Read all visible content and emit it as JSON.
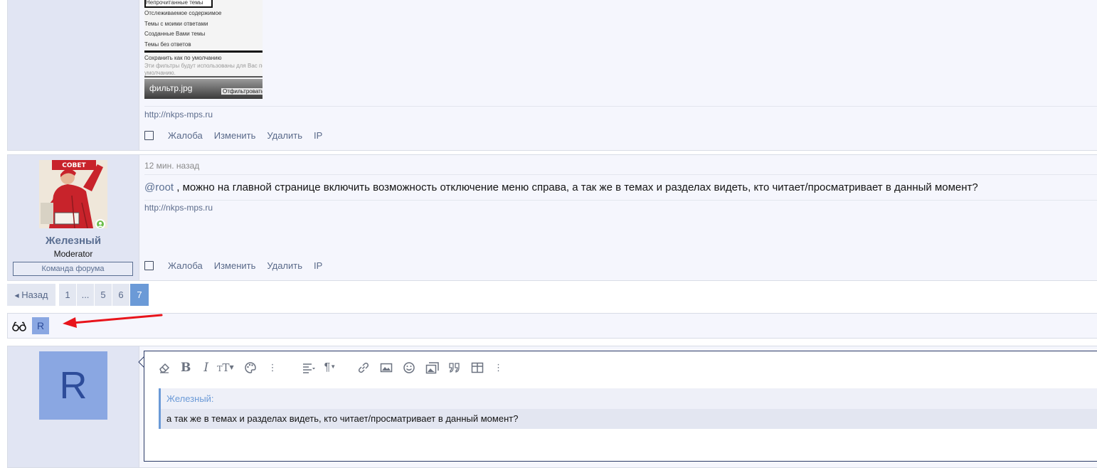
{
  "post1": {
    "attachment": {
      "menu_items": [
        "Непрочитанные темы",
        "Отслеживаемое содержимое",
        "Темы с моими ответами",
        "Созданные Вами темы",
        "Темы без ответов"
      ],
      "save_default": "Сохранить как по умолчанию",
      "save_hint_1": "Эти фильтры будут использованы для Вас по",
      "save_hint_2": "умолчанию.",
      "filename": "фильтр.jpg",
      "apply_button": "Отфильтровать"
    },
    "signature": "http://nkps-mps.ru",
    "actions": [
      "Жалоба",
      "Изменить",
      "Удалить",
      "IP"
    ]
  },
  "post2": {
    "user": {
      "name": "Железный",
      "title": "Moderator",
      "banner": "Команда форума"
    },
    "time": "12 мин. назад",
    "mention": "@root",
    "text": ", можно на главной странице включить возможность отключение меню справа, а так же в темах и разделах видеть, кто читает/просматривает в данный момент?",
    "signature": "http://nkps-mps.ru",
    "actions": [
      "Жалоба",
      "Изменить",
      "Удалить",
      "IP"
    ]
  },
  "pagination": {
    "prev": "Назад",
    "pages": [
      "1",
      "...",
      "5",
      "6",
      "7"
    ],
    "current": "7"
  },
  "readers": {
    "icon": "glasses-icon",
    "avatar_letter": "R"
  },
  "reply": {
    "avatar_letter": "R",
    "quote_author": "Железный:",
    "quote_text": "а так же в темах и разделах видеть, кто читает/просматривает в данный момент?"
  },
  "colors": {
    "accent": "#6b9ad7",
    "avatar_bg": "#8aa7e2",
    "avatar_letter": "#2d4c9a",
    "online": "#6dbf4b",
    "arrow": "#e8141b"
  }
}
